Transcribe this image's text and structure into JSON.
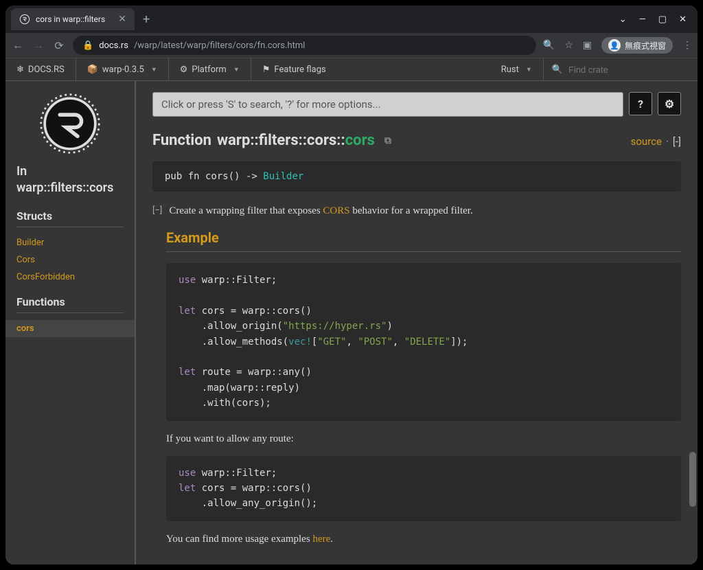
{
  "browser": {
    "tab_title": "cors in warp::filters",
    "url_host": "docs.rs",
    "url_path": "/warp/latest/warp/filters/cors/fn.cors.html",
    "profile_label": "無痕式視窗"
  },
  "docsnav": {
    "home": "DOCS.RS",
    "crate": "warp-0.3.5",
    "platform": "Platform",
    "flags": "Feature flags",
    "lang": "Rust",
    "search_placeholder": "Find crate"
  },
  "sidebar": {
    "location_prefix": "In",
    "location_path": "warp::filters::cors",
    "sections": {
      "structs": "Structs",
      "functions": "Functions"
    },
    "structs": [
      "Builder",
      "Cors",
      "CorsForbidden"
    ],
    "functions": [
      "cors"
    ]
  },
  "main": {
    "search_placeholder": "Click or press 'S' to search, '?' for more options...",
    "help_btn": "?",
    "heading_kw": "Function",
    "heading_path": "warp::filters::cors::",
    "heading_name": "cors",
    "source_label": "source",
    "collapse_label": "[-]",
    "decl_prefix": "pub fn cors() -> ",
    "decl_type": "Builder",
    "desc_prefix": "Create a wrapping filter that exposes ",
    "desc_link": "CORS",
    "desc_suffix": " behavior for a wrapped filter.",
    "example_heading": "Example",
    "code1": {
      "l1_kw": "use",
      "l1_rest": " warp::Filter;",
      "l2_kw": "let",
      "l2_rest": " cors = warp::cors()",
      "l3a": "    .allow_origin(",
      "l3s": "\"https://hyper.rs\"",
      "l3b": ")",
      "l4a": "    .allow_methods(",
      "l4m": "vec!",
      "l4b": "[",
      "l4s1": "\"GET\"",
      "l4c1": ", ",
      "l4s2": "\"POST\"",
      "l4c2": ", ",
      "l4s3": "\"DELETE\"",
      "l4d": "]);",
      "l5_kw": "let",
      "l5_rest": " route = warp::any()",
      "l6": "    .map(warp::reply)",
      "l7": "    .with(cors);"
    },
    "between": "If you want to allow any route:",
    "code2": {
      "l1_kw": "use",
      "l1_rest": " warp::Filter;",
      "l2_kw": "let",
      "l2_rest": " cors = warp::cors()",
      "l3": "    .allow_any_origin();"
    },
    "more_prefix": "You can find more usage examples ",
    "more_link": "here",
    "more_suffix": "."
  }
}
